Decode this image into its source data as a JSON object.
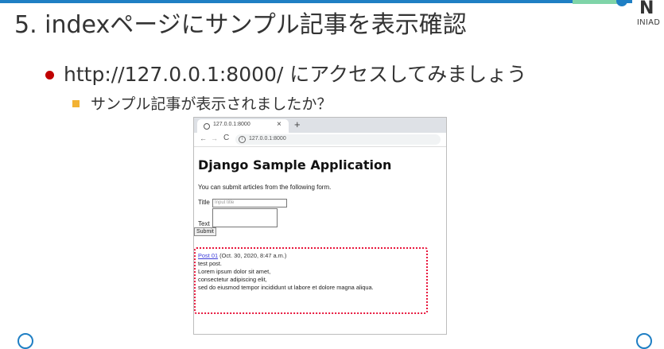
{
  "slide": {
    "title": "5. indexページにサンプル記事を表示確認",
    "bullet1": "http://127.0.0.1:8000/ にアクセスしてみましょう",
    "bullet2": "サンプル記事が表示されましたか？",
    "logo_text": "INIAD",
    "logo_glyph": "N",
    "colors": {
      "accent_blue": "#1f7fc4",
      "bullet_red": "#c00000",
      "bullet_orange": "#f2b233",
      "highlight_red": "#e8173d"
    }
  },
  "browser": {
    "tab_title": "127.0.0.1:8000",
    "tab_close": "×",
    "new_tab": "+",
    "back": "←",
    "forward": "→",
    "reload": "C",
    "info": "i",
    "url": "127.0.0.1:8000"
  },
  "page": {
    "heading": "Django Sample Application",
    "intro": "You can submit articles from the following form.",
    "title_label": "Title",
    "title_placeholder": "Input title",
    "text_label": "Text",
    "submit_label": "Submit",
    "post": {
      "link_text": "Post 01",
      "date": " (Oct. 30, 2020, 8:47 a.m.)",
      "lines": [
        "test post.",
        "Lorem ipsum dolor sit amet,",
        "consectetur adipiscing elit,",
        "sed do eiusmod tempor incididunt ut labore et dolore magna aliqua."
      ]
    }
  }
}
